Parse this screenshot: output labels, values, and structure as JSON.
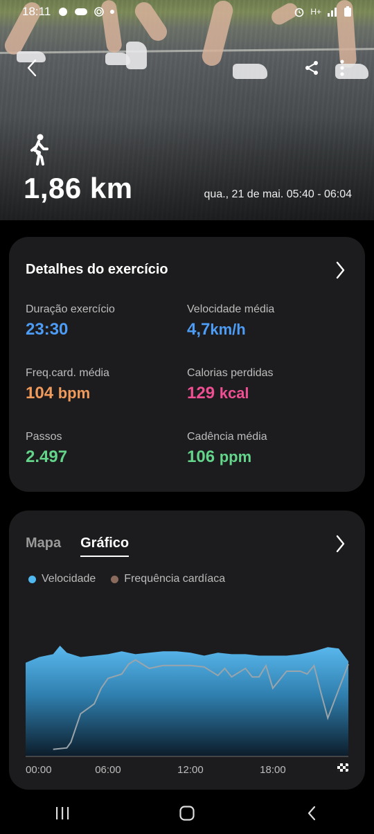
{
  "status_bar": {
    "time": "18:11",
    "network": "H+"
  },
  "hero": {
    "distance": "1,86 km",
    "datetime": "qua., 21 de mai. 05:40 - 06:04"
  },
  "details": {
    "title": "Detalhes do exercício",
    "metrics": [
      {
        "label": "Duração exercício",
        "value": "23:30",
        "unit": ""
      },
      {
        "label": "Velocidade média",
        "value": "4,7",
        "unit": "km/h"
      },
      {
        "label": "Freq.card. média",
        "value": "104",
        "unit": "bpm"
      },
      {
        "label": "Calorias perdidas",
        "value": "129",
        "unit": "kcal"
      },
      {
        "label": "Passos",
        "value": "2.497",
        "unit": ""
      },
      {
        "label": "Cadência média",
        "value": "106",
        "unit": "ppm"
      }
    ]
  },
  "graph_card": {
    "tabs": [
      {
        "label": "Mapa"
      },
      {
        "label": "Gráfico"
      }
    ],
    "active_tab": "Gráfico",
    "legend": [
      {
        "label": "Velocidade",
        "color": "#4fb8ef"
      },
      {
        "label": "Frequência cardíaca",
        "color": "#8a6a5c"
      }
    ]
  },
  "chart_data": {
    "type": "area",
    "x_ticks": [
      "00:00",
      "06:00",
      "12:00",
      "18:00"
    ],
    "x_range": [
      0,
      23.5
    ],
    "series": [
      {
        "name": "Velocidade",
        "x": [
          0,
          1,
          2,
          2.5,
          3,
          4,
          5,
          6,
          7,
          8,
          9,
          10,
          11,
          12,
          13,
          14,
          15,
          16,
          17,
          18,
          19,
          20,
          21,
          22,
          22.8,
          23.5
        ],
        "values": [
          0.66,
          0.7,
          0.72,
          0.78,
          0.73,
          0.7,
          0.71,
          0.72,
          0.74,
          0.72,
          0.73,
          0.74,
          0.74,
          0.73,
          0.71,
          0.73,
          0.72,
          0.72,
          0.71,
          0.71,
          0.71,
          0.72,
          0.74,
          0.77,
          0.76,
          0.67
        ]
      },
      {
        "name": "Frequência cardíaca",
        "x": [
          2,
          3,
          3.3,
          4,
          5,
          5.5,
          6,
          7,
          7.5,
          8,
          9,
          10,
          11,
          12,
          13,
          14,
          14.5,
          15,
          16,
          16.5,
          17,
          17.5,
          18,
          19,
          20,
          20.5,
          21,
          21.5,
          22,
          23.5
        ],
        "values": [
          0.05,
          0.06,
          0.1,
          0.3,
          0.37,
          0.48,
          0.55,
          0.58,
          0.65,
          0.68,
          0.62,
          0.64,
          0.64,
          0.64,
          0.63,
          0.57,
          0.62,
          0.56,
          0.62,
          0.56,
          0.56,
          0.64,
          0.48,
          0.6,
          0.6,
          0.58,
          0.64,
          0.45,
          0.27,
          0.65
        ]
      }
    ]
  }
}
